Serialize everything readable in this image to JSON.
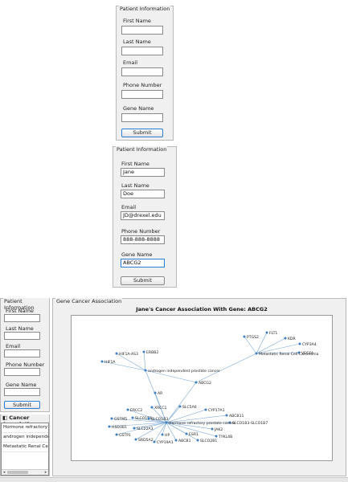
{
  "form_labels": {
    "first_name": "First Name",
    "last_name": "Last Name",
    "email": "Email",
    "phone": "Phone Number",
    "gene": "Gene Name",
    "submit": "Submit"
  },
  "form_top": {
    "title": "Patient Information",
    "first_name": "",
    "last_name": "",
    "email": "",
    "phone": "",
    "gene": ""
  },
  "form_middle": {
    "title": "Patient Information",
    "first_name": "Jane",
    "last_name": "Doe",
    "email": "JD@drexel.edu",
    "phone": "888-888-8888",
    "gene": "ABCG2"
  },
  "form_bottom": {
    "title": "Patient Information",
    "first_name": "",
    "last_name": "",
    "email": "",
    "phone": "",
    "gene": ""
  },
  "cancer_list": {
    "title": "Cancer Association",
    "items": [
      "Hormone refractory prostate cancer",
      "androgen independent prostate cancer",
      "Metastatic Renal Cell Carcinoma"
    ]
  },
  "gene_panel": {
    "title": "Gene Cancer Association",
    "plot_title": "Jane's Cancer Association With Gene: ABCG2"
  },
  "graph": {
    "edge_color": "#7aa7d6",
    "node_color": "#3d7fc1",
    "hubs": [
      "Hormone refractory prostate cancer",
      "androgen independent prostate cancer",
      "Metastatic Renal Cell Carcinoma",
      "ABCG2"
    ],
    "genes": [
      "PTGS2",
      "FLT1",
      "KDR",
      "CYP3A4",
      "VEGFA",
      "HIF1A-AS3",
      "ERBB2",
      "HIF1A",
      "AR",
      "SLC5A6",
      "CYP17A1",
      "ABCB11",
      "SLCO1B3-SLCO1B7",
      "JAK2",
      "TYKL4B",
      "SLCO2B1",
      "ESR1",
      "ABCB1",
      "CYP19A1",
      "SRD5A2",
      "GSTP1",
      "HSD3B1",
      "GSTM5",
      "ERCC2",
      "XRCC1",
      "SLCO1B1",
      "SLC22A3",
      "HP",
      "SLCO1B3"
    ]
  }
}
